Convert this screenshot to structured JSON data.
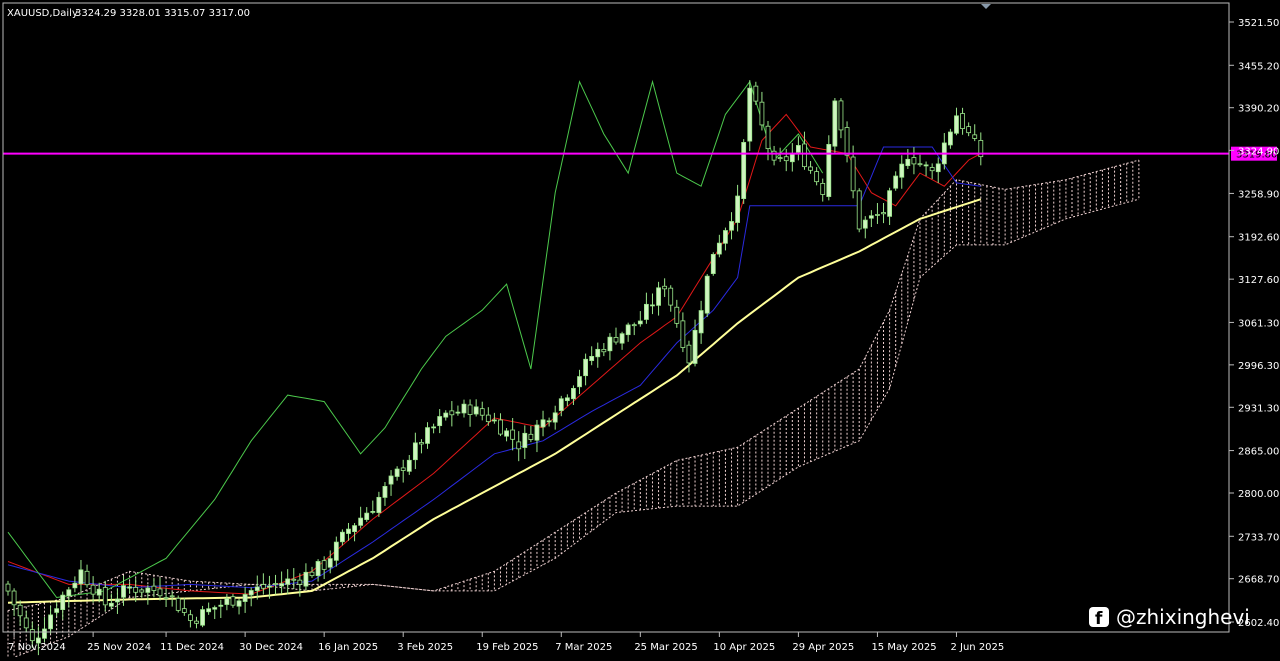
{
  "header": {
    "symbol": "XAUUSD,Daily",
    "ohlc": "3324.29 3328.01 3315.07 3317.00"
  },
  "price_line": {
    "value": 3319.8,
    "label": "3319.80",
    "color": "#ff00ff"
  },
  "watermark": {
    "handle": "@zhixinghevi",
    "icon": "facebook-icon"
  },
  "colors": {
    "background": "#000000",
    "bull_candle": "#cff5c0",
    "bear_candle": "#000000",
    "candle_wick": "#9ae68a",
    "tenkan": "#e01818",
    "kijun": "#2a2ae0",
    "chikou": "#4cc94c",
    "ma": "#ffff99",
    "cloud": "#f0d2d2"
  },
  "chart_data": {
    "type": "candlestick",
    "symbol": "XAUUSD",
    "timeframe": "Daily",
    "ylim": [
      2545,
      3545
    ],
    "y_ticks": [
      3521.5,
      3455.2,
      3390.2,
      3324.9,
      3258.9,
      3192.6,
      3127.6,
      3061.3,
      2996.3,
      2931.3,
      2865.0,
      2800.0,
      2733.7,
      2668.7,
      2602.4,
      2537.4
    ],
    "y_tick_labels": [
      "3521.50",
      "3455.20",
      "3390.20",
      "3324.90",
      "3258.90",
      "3192.60",
      "3127.60",
      "3061.30",
      "2996.30",
      "2931.30",
      "2865.00",
      "2800.00",
      "2733.70",
      "2668.70",
      "2602.40",
      "2537.40"
    ],
    "x_labels": [
      "7 Nov 2024",
      "25 Nov 2024",
      "11 Dec 2024",
      "30 Dec 2024",
      "16 Jan 2025",
      "3 Feb 2025",
      "19 Feb 2025",
      "7 Mar 2025",
      "25 Mar 2025",
      "10 Apr 2025",
      "29 Apr 2025",
      "15 May 2025",
      "2 Jun 2025"
    ],
    "x_label_bar_index": [
      1,
      14,
      26,
      39,
      52,
      65,
      78,
      91,
      104,
      117,
      130,
      143,
      156
    ],
    "close_keypoints": [
      [
        0,
        2650
      ],
      [
        4,
        2570
      ],
      [
        8,
        2630
      ],
      [
        12,
        2680
      ],
      [
        16,
        2630
      ],
      [
        20,
        2655
      ],
      [
        26,
        2650
      ],
      [
        30,
        2605
      ],
      [
        34,
        2625
      ],
      [
        40,
        2650
      ],
      [
        44,
        2660
      ],
      [
        48,
        2670
      ],
      [
        52,
        2690
      ],
      [
        56,
        2745
      ],
      [
        60,
        2780
      ],
      [
        64,
        2830
      ],
      [
        68,
        2880
      ],
      [
        72,
        2920
      ],
      [
        76,
        2930
      ],
      [
        80,
        2910
      ],
      [
        84,
        2875
      ],
      [
        88,
        2910
      ],
      [
        92,
        2955
      ],
      [
        96,
        3010
      ],
      [
        100,
        3040
      ],
      [
        104,
        3065
      ],
      [
        108,
        3120
      ],
      [
        112,
        3005
      ],
      [
        116,
        3170
      ],
      [
        120,
        3245
      ],
      [
        122,
        3420
      ],
      [
        126,
        3300
      ],
      [
        130,
        3325
      ],
      [
        134,
        3265
      ],
      [
        136,
        3410
      ],
      [
        140,
        3210
      ],
      [
        144,
        3230
      ],
      [
        148,
        3320
      ],
      [
        152,
        3290
      ],
      [
        156,
        3380
      ],
      [
        160,
        3317
      ]
    ],
    "series": [
      {
        "name": "Tenkan",
        "keypoints": [
          [
            0,
            2695
          ],
          [
            10,
            2660
          ],
          [
            20,
            2660
          ],
          [
            30,
            2650
          ],
          [
            40,
            2645
          ],
          [
            50,
            2680
          ],
          [
            60,
            2760
          ],
          [
            70,
            2830
          ],
          [
            80,
            2915
          ],
          [
            88,
            2900
          ],
          [
            96,
            2965
          ],
          [
            104,
            3030
          ],
          [
            110,
            3070
          ],
          [
            116,
            3160
          ],
          [
            120,
            3220
          ],
          [
            124,
            3340
          ],
          [
            128,
            3380
          ],
          [
            132,
            3330
          ],
          [
            138,
            3320
          ],
          [
            142,
            3260
          ],
          [
            146,
            3240
          ],
          [
            150,
            3290
          ],
          [
            154,
            3270
          ],
          [
            158,
            3310
          ],
          [
            160,
            3320
          ]
        ]
      },
      {
        "name": "Kijun",
        "keypoints": [
          [
            0,
            2690
          ],
          [
            10,
            2665
          ],
          [
            20,
            2655
          ],
          [
            30,
            2660
          ],
          [
            40,
            2655
          ],
          [
            50,
            2665
          ],
          [
            60,
            2725
          ],
          [
            70,
            2790
          ],
          [
            80,
            2860
          ],
          [
            88,
            2880
          ],
          [
            96,
            2925
          ],
          [
            104,
            2965
          ],
          [
            110,
            3030
          ],
          [
            116,
            3080
          ],
          [
            120,
            3130
          ],
          [
            122,
            3240
          ],
          [
            130,
            3240
          ],
          [
            140,
            3240
          ],
          [
            144,
            3330
          ],
          [
            152,
            3330
          ],
          [
            156,
            3275
          ],
          [
            160,
            3270
          ]
        ]
      },
      {
        "name": "Chikou",
        "keypoints": [
          [
            0,
            2740
          ],
          [
            8,
            2640
          ],
          [
            16,
            2650
          ],
          [
            26,
            2700
          ],
          [
            34,
            2790
          ],
          [
            40,
            2880
          ],
          [
            46,
            2950
          ],
          [
            52,
            2940
          ],
          [
            58,
            2860
          ],
          [
            62,
            2900
          ],
          [
            68,
            2990
          ],
          [
            72,
            3040
          ],
          [
            78,
            3080
          ],
          [
            82,
            3120
          ],
          [
            86,
            2990
          ],
          [
            90,
            3260
          ],
          [
            94,
            3430
          ],
          [
            98,
            3350
          ],
          [
            102,
            3290
          ],
          [
            106,
            3430
          ],
          [
            110,
            3290
          ],
          [
            114,
            3270
          ],
          [
            118,
            3380
          ],
          [
            122,
            3430
          ],
          [
            126,
            3310
          ],
          [
            130,
            3350
          ],
          [
            134,
            3290
          ]
        ]
      },
      {
        "name": "MA",
        "keypoints": [
          [
            0,
            2632
          ],
          [
            20,
            2637
          ],
          [
            40,
            2640
          ],
          [
            50,
            2650
          ],
          [
            60,
            2700
          ],
          [
            70,
            2760
          ],
          [
            80,
            2810
          ],
          [
            90,
            2860
          ],
          [
            100,
            2920
          ],
          [
            110,
            2980
          ],
          [
            120,
            3060
          ],
          [
            130,
            3130
          ],
          [
            140,
            3170
          ],
          [
            150,
            3220
          ],
          [
            160,
            3250
          ]
        ]
      }
    ],
    "cloud": {
      "span_a": [
        [
          0,
          2620
        ],
        [
          10,
          2640
        ],
        [
          20,
          2680
        ],
        [
          30,
          2665
        ],
        [
          40,
          2660
        ],
        [
          50,
          2660
        ],
        [
          60,
          2660
        ],
        [
          70,
          2650
        ],
        [
          80,
          2680
        ],
        [
          90,
          2740
        ],
        [
          100,
          2800
        ],
        [
          110,
          2850
        ],
        [
          120,
          2870
        ],
        [
          130,
          2930
        ],
        [
          140,
          2990
        ],
        [
          145,
          3080
        ],
        [
          150,
          3220
        ],
        [
          156,
          3280
        ],
        [
          164,
          3265
        ],
        [
          174,
          3280
        ],
        [
          186,
          3310
        ]
      ],
      "span_b": [
        [
          0,
          2545
        ],
        [
          10,
          2580
        ],
        [
          20,
          2640
        ],
        [
          30,
          2650
        ],
        [
          40,
          2660
        ],
        [
          50,
          2650
        ],
        [
          60,
          2660
        ],
        [
          70,
          2650
        ],
        [
          80,
          2650
        ],
        [
          90,
          2700
        ],
        [
          100,
          2770
        ],
        [
          110,
          2780
        ],
        [
          120,
          2780
        ],
        [
          130,
          2840
        ],
        [
          140,
          2880
        ],
        [
          145,
          2960
        ],
        [
          150,
          3130
        ],
        [
          156,
          3180
        ],
        [
          164,
          3180
        ],
        [
          174,
          3220
        ],
        [
          186,
          3250
        ]
      ]
    }
  }
}
